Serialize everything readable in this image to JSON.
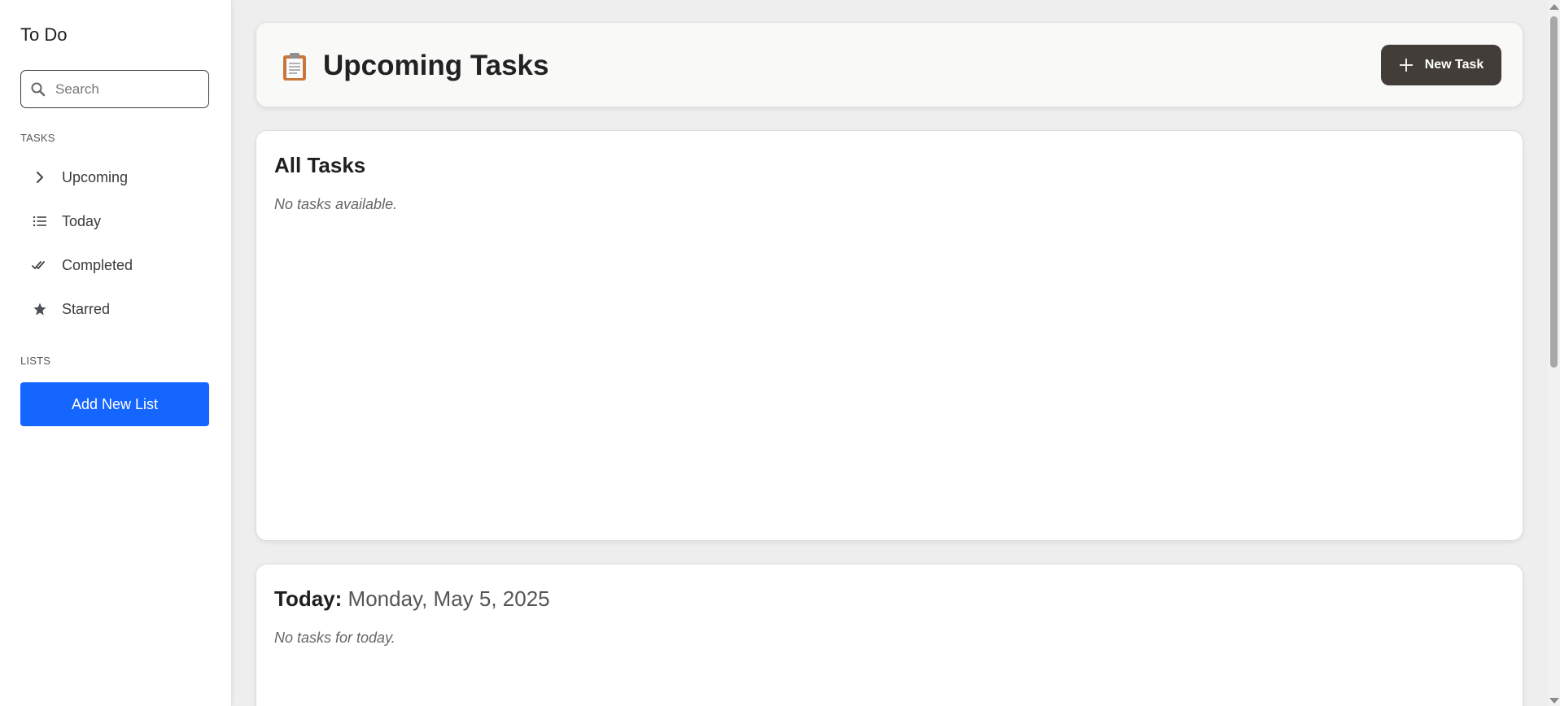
{
  "sidebar": {
    "app_title": "To Do",
    "search": {
      "placeholder": "Search",
      "value": ""
    },
    "tasks_label": "TASKS",
    "items": [
      {
        "label": "Upcoming",
        "icon": "chevron-right-icon"
      },
      {
        "label": "Today",
        "icon": "list-icon"
      },
      {
        "label": "Completed",
        "icon": "double-check-icon"
      },
      {
        "label": "Starred",
        "icon": "star-icon"
      }
    ],
    "lists_label": "LISTS",
    "add_list_label": "Add New List"
  },
  "header": {
    "icon": "clipboard-icon",
    "title": "Upcoming Tasks",
    "new_task_label": "New Task"
  },
  "all_tasks": {
    "title": "All Tasks",
    "empty_text": "No tasks available."
  },
  "today": {
    "title_prefix": "Today:",
    "date": "Monday, May 5, 2025",
    "empty_text": "No tasks for today."
  },
  "colors": {
    "accent_blue": "#1565ff",
    "dark_button": "#423d38"
  }
}
